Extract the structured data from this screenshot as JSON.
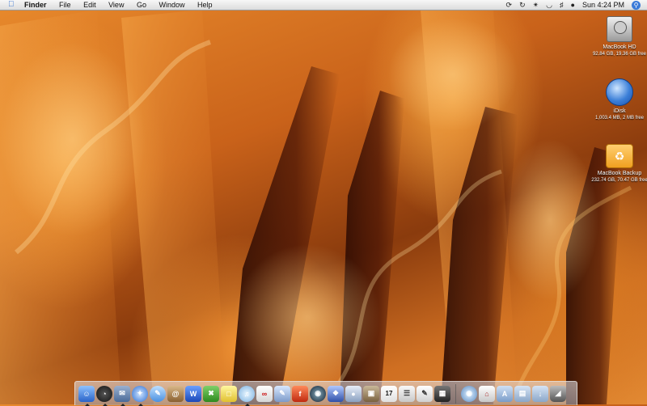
{
  "menubar": {
    "apple_icon": "apple-logo",
    "items": [
      "Finder",
      "File",
      "Edit",
      "View",
      "Go",
      "Window",
      "Help"
    ],
    "status_icons": [
      "sync-icon",
      "time-machine-icon",
      "bluetooth-icon",
      "wifi-icon",
      "volume-icon",
      "user-icon"
    ],
    "clock": "Sun 4:24 PM",
    "spotlight_icon": "spotlight-icon"
  },
  "desktop_icons": [
    {
      "name": "MacBook HD",
      "info": "92.84 GB, 19.36 GB free"
    },
    {
      "name": "iDisk",
      "info": "1,003.4 MB, 2 MB free"
    },
    {
      "name": "MacBook Backup",
      "info": "232.74 GB, 70.47 GB free"
    }
  ],
  "dock": {
    "apps": [
      {
        "name": "finder-icon",
        "running": true
      },
      {
        "name": "dashboard-icon",
        "running": true
      },
      {
        "name": "mail-stamp-icon",
        "running": true
      },
      {
        "name": "safari-icon",
        "running": true
      },
      {
        "name": "ichat-icon",
        "running": false
      },
      {
        "name": "address-book-icon",
        "running": false
      },
      {
        "name": "word-icon",
        "running": false
      },
      {
        "name": "excel-icon",
        "running": false
      },
      {
        "name": "note-icon",
        "running": false
      },
      {
        "name": "itunes-icon",
        "running": true
      },
      {
        "name": "acrobat-icon",
        "running": false
      },
      {
        "name": "pen-icon",
        "running": false
      },
      {
        "name": "flash-icon",
        "running": false
      },
      {
        "name": "camera-icon",
        "running": false
      },
      {
        "name": "network-icon",
        "running": false
      },
      {
        "name": "preview-icon",
        "running": false
      },
      {
        "name": "photo-icon",
        "running": false
      },
      {
        "name": "ical-icon",
        "running": false
      },
      {
        "name": "paper-icon",
        "running": false
      },
      {
        "name": "textedit-icon",
        "running": false
      },
      {
        "name": "calculator-icon",
        "running": false
      }
    ],
    "right": [
      {
        "name": "globe-icon"
      },
      {
        "name": "home-folder-icon"
      },
      {
        "name": "applications-folder-icon"
      },
      {
        "name": "documents-folder-icon"
      },
      {
        "name": "downloads-folder-icon"
      },
      {
        "name": "trash-icon"
      }
    ],
    "calendar_day": "17",
    "word_letter": "W"
  }
}
